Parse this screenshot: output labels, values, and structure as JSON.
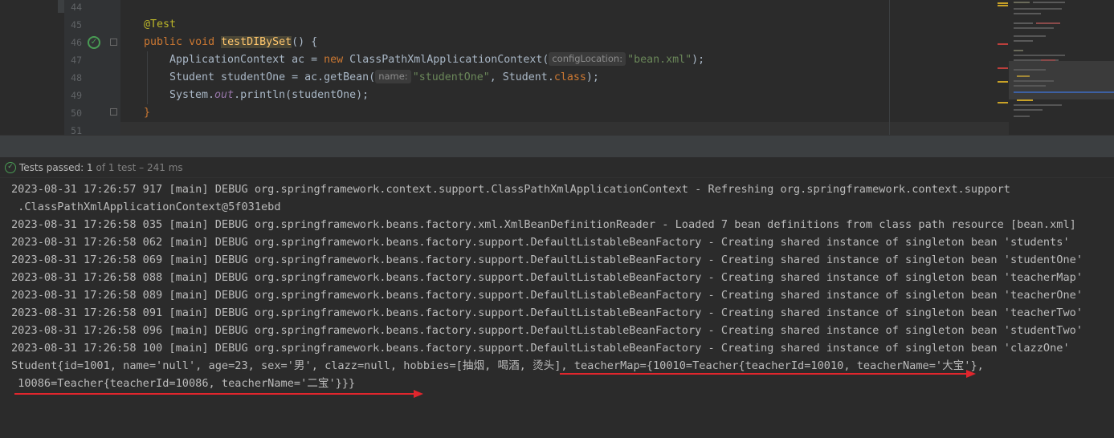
{
  "editor": {
    "line_numbers": [
      "44",
      "45",
      "46",
      "47",
      "48",
      "49",
      "50",
      "51"
    ],
    "line45": {
      "annotation": "@Test"
    },
    "line46": {
      "kw_public": "public",
      "kw_void": "void",
      "method_name": "testDIBySet",
      "tail": "() {"
    },
    "line47": {
      "part1": "ApplicationContext ac = ",
      "kw_new": "new",
      "part2": " ClassPathXmlApplicationContext(",
      "hint": "configLocation:",
      "arg": "\"bean.xml\"",
      "tail": ");"
    },
    "line48": {
      "part1": "Student studentOne = ac.getBean(",
      "hint": "name:",
      "arg": "\"studentOne\"",
      "mid": ", Student.",
      "kw_class": "class",
      "tail": ");"
    },
    "line49": {
      "part1": "System.",
      "field": "out",
      "tail": ".println(studentOne);"
    },
    "line50": {
      "brace": "}"
    }
  },
  "status": {
    "passed_label": "Tests passed: 1",
    "detail": " of 1 test – 241 ms"
  },
  "console": {
    "lines": [
      "2023-08-31 17:26:57 917 [main] DEBUG org.springframework.context.support.ClassPathXmlApplicationContext - Refreshing org.springframework.context.support",
      " .ClassPathXmlApplicationContext@5f031ebd",
      "2023-08-31 17:26:58 035 [main] DEBUG org.springframework.beans.factory.xml.XmlBeanDefinitionReader - Loaded 7 bean definitions from class path resource [bean.xml]",
      "2023-08-31 17:26:58 062 [main] DEBUG org.springframework.beans.factory.support.DefaultListableBeanFactory - Creating shared instance of singleton bean 'students'",
      "2023-08-31 17:26:58 069 [main] DEBUG org.springframework.beans.factory.support.DefaultListableBeanFactory - Creating shared instance of singleton bean 'studentOne'",
      "2023-08-31 17:26:58 088 [main] DEBUG org.springframework.beans.factory.support.DefaultListableBeanFactory - Creating shared instance of singleton bean 'teacherMap'",
      "2023-08-31 17:26:58 089 [main] DEBUG org.springframework.beans.factory.support.DefaultListableBeanFactory - Creating shared instance of singleton bean 'teacherOne'",
      "2023-08-31 17:26:58 091 [main] DEBUG org.springframework.beans.factory.support.DefaultListableBeanFactory - Creating shared instance of singleton bean 'teacherTwo'",
      "2023-08-31 17:26:58 096 [main] DEBUG org.springframework.beans.factory.support.DefaultListableBeanFactory - Creating shared instance of singleton bean 'studentTwo'",
      "2023-08-31 17:26:58 100 [main] DEBUG org.springframework.beans.factory.support.DefaultListableBeanFactory - Creating shared instance of singleton bean 'clazzOne'",
      "Student{id=1001, name='null', age=23, sex='男', clazz=null, hobbies=[抽烟, 喝酒, 烫头], teacherMap={10010=Teacher{teacherId=10010, teacherName='大宝'},",
      " 10086=Teacher{teacherId=10086, teacherName='二宝'}}}"
    ]
  },
  "colors": {
    "annotation_red": "#e0262d",
    "pass_green": "#499c54"
  }
}
